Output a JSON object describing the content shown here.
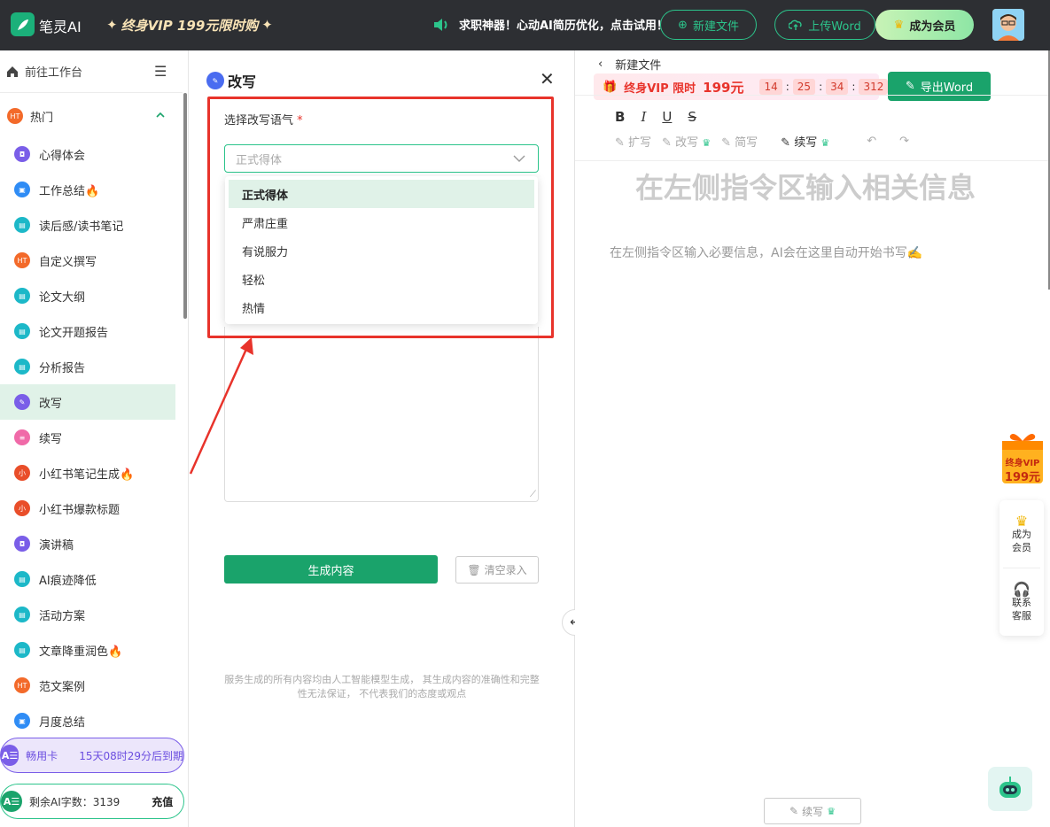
{
  "topbar": {
    "app_name": "笔灵AI",
    "vip_promo": "终身VIP 199元限时购",
    "notice": "求职神器！心动AI简历优化，点击试用！",
    "new_file": "新建文件",
    "upload_word": "上传Word",
    "become_member": "成为会员"
  },
  "sidebar": {
    "back": "前往工作台",
    "section": "热门",
    "items": [
      {
        "label": "心得体会",
        "icon": "purple"
      },
      {
        "label": "工作总结🔥",
        "icon": "blue"
      },
      {
        "label": "读后感/读书笔记",
        "icon": "teal"
      },
      {
        "label": "自定义撰写",
        "icon": "orange"
      },
      {
        "label": "论文大纲",
        "icon": "teal"
      },
      {
        "label": "论文开题报告",
        "icon": "teal"
      },
      {
        "label": "分析报告",
        "icon": "teal"
      },
      {
        "label": "改写",
        "icon": "purple"
      },
      {
        "label": "续写",
        "icon": "pink"
      },
      {
        "label": "小红书笔记生成🔥",
        "icon": "red"
      },
      {
        "label": "小红书爆款标题",
        "icon": "red"
      },
      {
        "label": "演讲稿",
        "icon": "purple"
      },
      {
        "label": "AI痕迹降低",
        "icon": "teal"
      },
      {
        "label": "活动方案",
        "icon": "teal"
      },
      {
        "label": "文章降重润色🔥",
        "icon": "teal"
      },
      {
        "label": "范文案例",
        "icon": "orange"
      },
      {
        "label": "月度总结",
        "icon": "blue"
      }
    ],
    "card1_name": "畅用卡",
    "card1_expiry": "15天08时29分后到期",
    "card2_label": "剩余AI字数：3139",
    "card2_action": "充值",
    "ae": "A☰"
  },
  "panel": {
    "title": "改写",
    "tone_label": "选择改写语气",
    "required_mark": "*",
    "select_placeholder": "正式得体",
    "options": [
      "正式得体",
      "严肃庄重",
      "有说服力",
      "轻松",
      "热情"
    ],
    "generate": "生成内容",
    "clear": "清空录入",
    "disclaimer_line1": "服务生成的所有内容均由人工智能模型生成， 其生成内容的准确性和完整",
    "disclaimer_line2": "性无法保证， 不代表我们的态度或观点"
  },
  "editor": {
    "breadcrumb": "新建文件",
    "vip_text": "终身VIP 限时",
    "vip_price": "199元",
    "timer": [
      "14",
      "25",
      "34",
      "312"
    ],
    "export": "导出Word",
    "tools": {
      "expand": "扩写",
      "rewrite": "改写",
      "shorten": "简写",
      "continue": "续写"
    },
    "placeholder_title": "在左侧指令区输入相关信息",
    "placeholder_text": "在左侧指令区输入必要信息，AI会在这里自动开始书写✍️",
    "bottom_continue": "续写"
  },
  "float": {
    "vip_line1": "终身VIP",
    "vip_line2": "199元",
    "member": [
      "成为",
      "会员"
    ],
    "service": [
      "联系",
      "客服"
    ]
  },
  "colors": {
    "accent": "#1aa36b",
    "highlight": "#e8332b",
    "active_bg": "#e0f2e8"
  }
}
